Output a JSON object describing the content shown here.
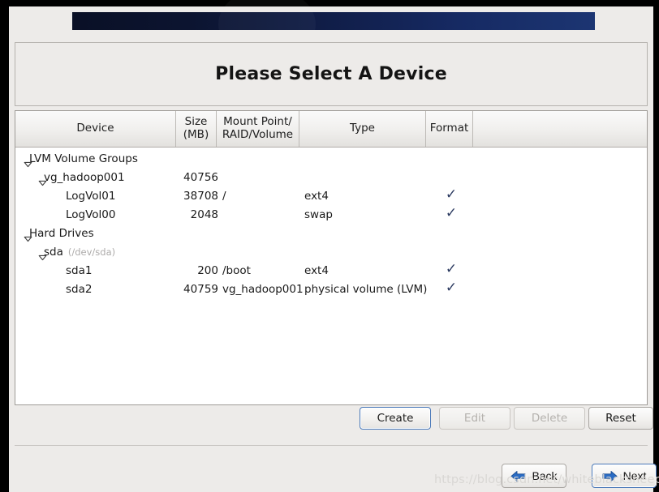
{
  "window": {
    "title": "Please Select A Device"
  },
  "banner": {
    "name": "installer-banner",
    "gradient_from": "#0a1026",
    "gradient_to": "#1c3572"
  },
  "table": {
    "columns": [
      {
        "label": "Device",
        "sublabel": ""
      },
      {
        "label": "Size",
        "sublabel": "(MB)"
      },
      {
        "label": "Mount Point/",
        "sublabel": "RAID/Volume"
      },
      {
        "label": "Type",
        "sublabel": ""
      },
      {
        "label": "Format",
        "sublabel": ""
      }
    ],
    "check_glyph": "✓",
    "check_color": "#2b3a60",
    "rows": [
      {
        "device": "LVM Volume Groups",
        "path": "",
        "indent": 0,
        "expander": "expanded",
        "size": "",
        "mount": "",
        "type": "",
        "format": false
      },
      {
        "device": "vg_hadoop001",
        "path": "",
        "indent": 1,
        "expander": "expanded",
        "size": "40756",
        "mount": "",
        "type": "",
        "format": false
      },
      {
        "device": "LogVol01",
        "path": "",
        "indent": 2,
        "expander": "none",
        "size": "38708",
        "mount": "/",
        "type": "ext4",
        "format": true
      },
      {
        "device": "LogVol00",
        "path": "",
        "indent": 2,
        "expander": "none",
        "size": "2048",
        "mount": "",
        "type": "swap",
        "format": true
      },
      {
        "device": "Hard Drives",
        "path": "",
        "indent": 0,
        "expander": "expanded",
        "size": "",
        "mount": "",
        "type": "",
        "format": false
      },
      {
        "device": "sda",
        "path": "(/dev/sda)",
        "indent": 1,
        "expander": "expanded",
        "size": "",
        "mount": "",
        "type": "",
        "format": false
      },
      {
        "device": "sda1",
        "path": "",
        "indent": 2,
        "expander": "none",
        "size": "200",
        "mount": "/boot",
        "type": "ext4",
        "format": true
      },
      {
        "device": "sda2",
        "path": "",
        "indent": 2,
        "expander": "none",
        "size": "40759",
        "mount": "vg_hadoop001",
        "type": "physical volume (LVM)",
        "format": true
      }
    ]
  },
  "actions": {
    "create_label": "Create",
    "edit_label": "Edit",
    "delete_label": "Delete",
    "reset_label": "Reset"
  },
  "nav": {
    "back_label": "Back",
    "next_label": "Next",
    "arrow_color": "#2a6cc4"
  },
  "watermark": {
    "text": "https://blog.csdn.net/whiteblacksheep"
  }
}
